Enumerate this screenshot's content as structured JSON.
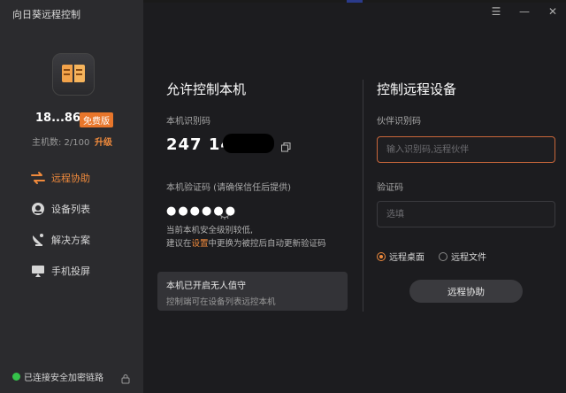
{
  "app": {
    "title": "向日葵远程控制"
  },
  "window_controls": {
    "menu": "☰",
    "minimize": "—",
    "close": "✕"
  },
  "user": {
    "id": "18...86",
    "badge": "免费版",
    "host_count": "主机数: 2/100",
    "upgrade": "升级"
  },
  "nav": {
    "items": [
      {
        "label": "远程协助",
        "icon": "swap-arrows-icon",
        "active": true
      },
      {
        "label": "设备列表",
        "icon": "device-list-icon",
        "active": false
      },
      {
        "label": "解决方案",
        "icon": "satellite-dish-icon",
        "active": false
      },
      {
        "label": "手机投屏",
        "icon": "screen-cast-icon",
        "active": false
      }
    ]
  },
  "status": {
    "text": "已连接安全加密链路"
  },
  "local": {
    "title": "允许控制本机",
    "id_label": "本机识别码",
    "id_value": "247 14",
    "code_label": "本机验证码 (请确保信任后提供)",
    "code_value": "●●●●●●",
    "hint_line1": "当前本机安全级别较低,",
    "hint_line2_pre": "建议在",
    "hint_line2_link": "设置",
    "hint_line2_post": "中更换为被控后自动更新验证码",
    "unattended_title": "本机已开启无人值守",
    "unattended_sub": "控制端可在设备列表远控本机"
  },
  "remote": {
    "title": "控制远程设备",
    "partner_label": "伙伴识别码",
    "partner_placeholder": "输入识别码,远程伙伴",
    "code_label": "验证码",
    "code_placeholder": "选填",
    "radio_desktop": "远程桌面",
    "radio_files": "远程文件",
    "connect_label": "远程协助"
  },
  "colors": {
    "accent": "#f08a3c",
    "status_green": "#35c24a",
    "bg": "#1c1c1f",
    "sidebar": "#2b2b2e"
  }
}
